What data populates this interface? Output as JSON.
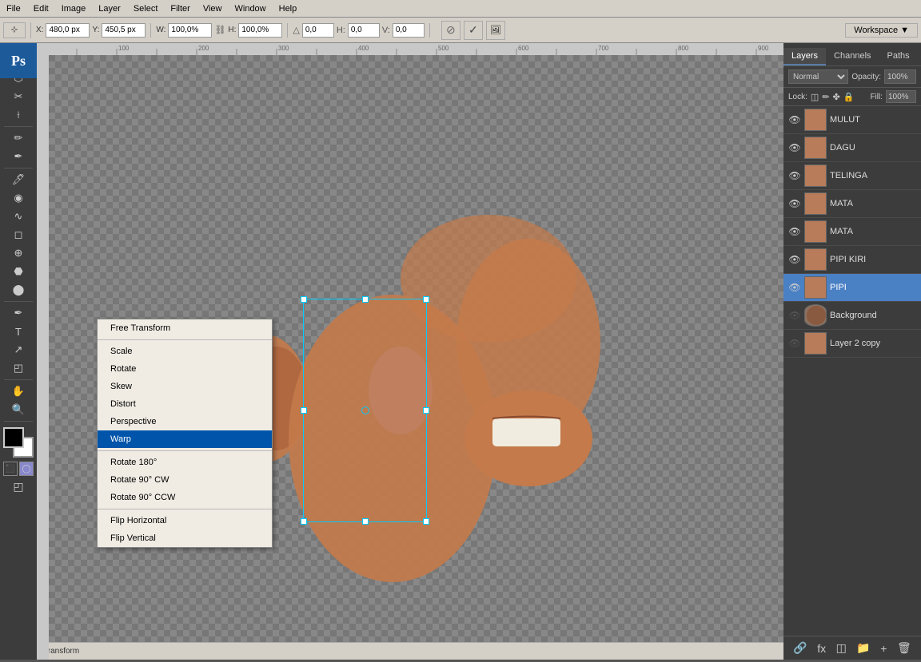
{
  "app": {
    "title": "Adobe Photoshop"
  },
  "menubar": {
    "items": [
      "File",
      "Edit",
      "Image",
      "Layer",
      "Select",
      "Filter",
      "View",
      "Window",
      "Help"
    ]
  },
  "toolbar": {
    "x_label": "X:",
    "x_value": "480,0 px",
    "y_label": "Y:",
    "y_value": "450,5 px",
    "w_label": "W:",
    "w_value": "100,0%",
    "h_label": "H:",
    "h_value": "100,0%",
    "angle_value": "0,0",
    "h2_value": "0,0",
    "v_value": "0,0",
    "workspace_label": "Workspace"
  },
  "context_menu": {
    "items": [
      {
        "label": "Free Transform",
        "active": false,
        "has_separator_before": false
      },
      {
        "label": "Scale",
        "active": false,
        "has_separator_before": true
      },
      {
        "label": "Rotate",
        "active": false,
        "has_separator_before": false
      },
      {
        "label": "Skew",
        "active": false,
        "has_separator_before": false
      },
      {
        "label": "Distort",
        "active": false,
        "has_separator_before": false
      },
      {
        "label": "Perspective",
        "active": false,
        "has_separator_before": false
      },
      {
        "label": "Warp",
        "active": true,
        "has_separator_before": false
      },
      {
        "label": "Rotate 180°",
        "active": false,
        "has_separator_before": true
      },
      {
        "label": "Rotate 90° CW",
        "active": false,
        "has_separator_before": false
      },
      {
        "label": "Rotate 90° CCW",
        "active": false,
        "has_separator_before": false
      },
      {
        "label": "Flip Horizontal",
        "active": false,
        "has_separator_before": true
      },
      {
        "label": "Flip Vertical",
        "active": false,
        "has_separator_before": false
      }
    ]
  },
  "layers_panel": {
    "blend_mode": "Normal",
    "opacity_label": "Opacity:",
    "opacity_value": "100%",
    "lock_label": "Lock:",
    "fill_label": "Fill:",
    "fill_value": "100%",
    "tabs": [
      "Layers",
      "Channels",
      "Paths"
    ],
    "layers": [
      {
        "name": "MULUT",
        "visible": true,
        "selected": false,
        "type": "thumb"
      },
      {
        "name": "DAGU",
        "visible": true,
        "selected": false,
        "type": "thumb"
      },
      {
        "name": "TELINGA",
        "visible": true,
        "selected": false,
        "type": "thumb"
      },
      {
        "name": "MATA",
        "visible": true,
        "selected": false,
        "type": "thumb"
      },
      {
        "name": "MATA",
        "visible": true,
        "selected": false,
        "type": "thumb"
      },
      {
        "name": "PIPI KIRI",
        "visible": true,
        "selected": false,
        "type": "thumb"
      },
      {
        "name": "PIPI",
        "visible": true,
        "selected": true,
        "type": "thumb"
      },
      {
        "name": "Background",
        "visible": false,
        "selected": false,
        "type": "bg"
      },
      {
        "name": "Layer 2 copy",
        "visible": false,
        "selected": false,
        "type": "thumb"
      }
    ]
  },
  "tools": {
    "icons": [
      "⊹",
      "↖",
      "✂",
      "⬡",
      "⟊",
      "✏",
      "✒",
      "∿",
      "🖊",
      "⬣",
      "⬤",
      "◻",
      "⊕",
      "◉",
      "T",
      "↗",
      "✋",
      "🔍",
      "⬛",
      "◯",
      "◰"
    ]
  }
}
